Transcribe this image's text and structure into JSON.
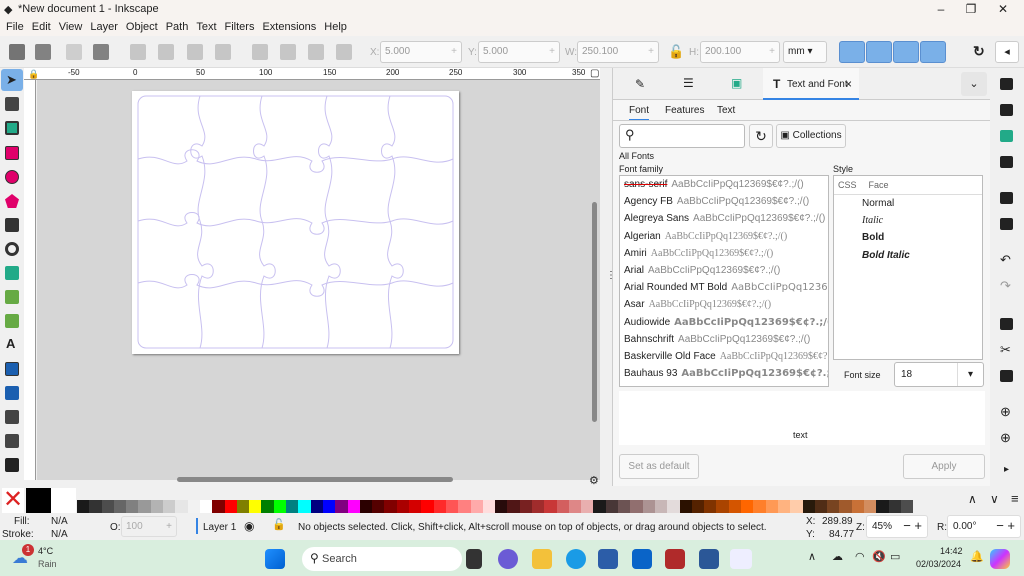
{
  "window": {
    "title": "*New document 1 - Inkscape",
    "minimize": "–",
    "maximize": "❐",
    "close": "✕"
  },
  "menu": [
    "File",
    "Edit",
    "View",
    "Layer",
    "Object",
    "Path",
    "Text",
    "Filters",
    "Extensions",
    "Help"
  ],
  "toolbar": {
    "x_label": "X:",
    "x": "5.000",
    "y_label": "Y:",
    "y": "5.000",
    "w_label": "W:",
    "w": "250.100",
    "h_label": "H:",
    "h": "200.100",
    "units": "mm",
    "stepper_minus": "−",
    "stepper_plus": "+"
  },
  "ruler": [
    "-50",
    "0",
    "50",
    "100",
    "150",
    "200",
    "250",
    "300",
    "350"
  ],
  "panel": {
    "active_tab": "Text and Font",
    "tab_close": "×",
    "subtabs": [
      "Font",
      "Features",
      "Text"
    ],
    "collections": "Collections",
    "all_fonts": "All Fonts",
    "font_family_label": "Font family",
    "style_label": "Style",
    "style_headers": [
      "CSS",
      "Face"
    ],
    "styles": [
      "Normal",
      "Italic",
      "Bold",
      "Bold Italic"
    ],
    "font_size_label": "Font size",
    "font_size": "18",
    "sample": "AaBbCcIiPpQq12369$€¢?.;/()",
    "fonts": [
      "sans-serif",
      "Agency FB",
      "Alegreya Sans",
      "Algerian",
      "Amiri",
      "Arial",
      "Arial Rounded MT Bold",
      "Asar",
      "Audiowide",
      "Bahnschrift",
      "Baskerville Old Face",
      "Bauhaus 93"
    ],
    "preview_text": "text",
    "set_default": "Set as default",
    "apply": "Apply"
  },
  "status": {
    "fill_label": "Fill:",
    "fill": "N/A",
    "stroke_label": "Stroke:",
    "stroke": "N/A",
    "opacity_label": "O:",
    "opacity": "100",
    "layer": "Layer 1",
    "message": "No objects selected. Click, Shift+click, Alt+scroll mouse on top of objects, or drag around objects to select.",
    "x_label": "X:",
    "x": "289.89",
    "y_label": "Y:",
    "y": "84.77",
    "zoom_label": "Z:",
    "zoom": "45%",
    "rotate_label": "R:",
    "rotate": "0.00°"
  },
  "taskbar": {
    "temp": "4°C",
    "weather": "Rain",
    "badge": "1",
    "search": "Search",
    "time": "14:42",
    "date": "02/03/2024"
  },
  "colors": {
    "accent": "#7ab0e8",
    "puzzle_line": "#c8c0f0",
    "taskbar": "#d9eede"
  }
}
